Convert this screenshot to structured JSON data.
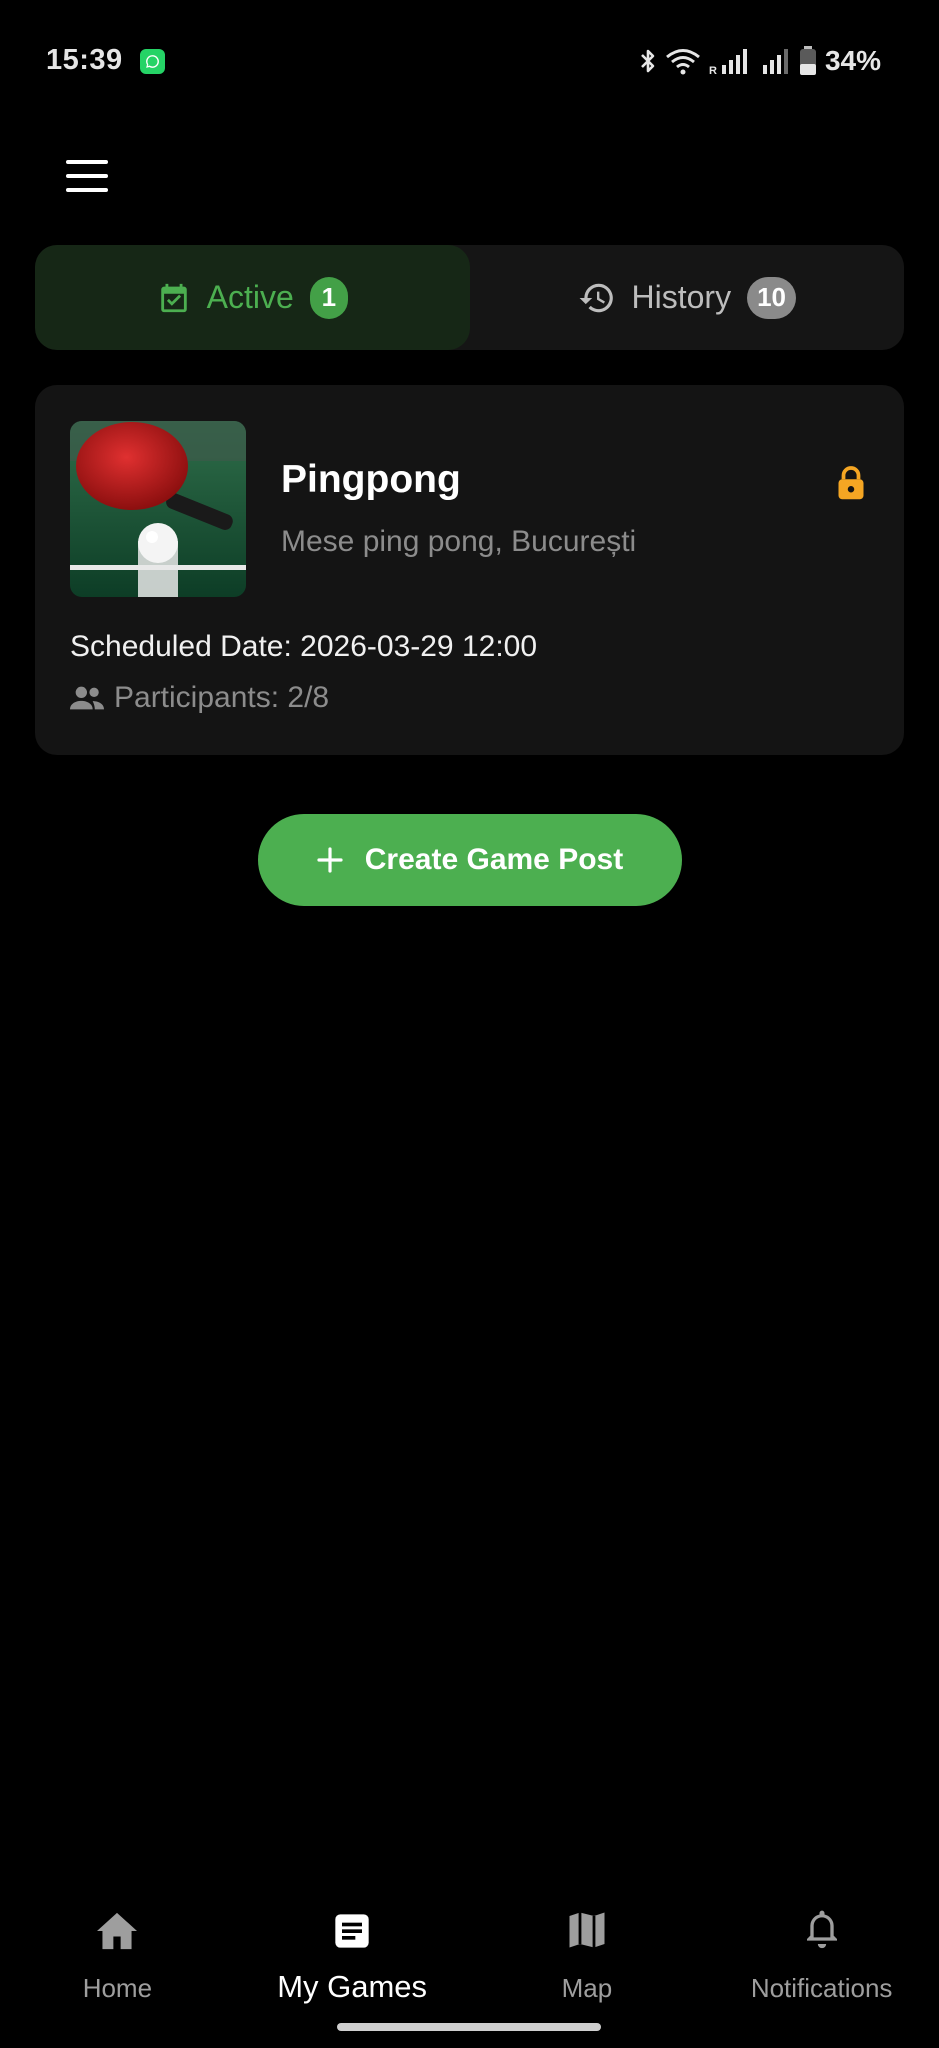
{
  "status_bar": {
    "time": "15:39",
    "battery": "34%",
    "icons": [
      "whatsapp-icon",
      "bluetooth-icon",
      "wifi-icon",
      "signal-icon",
      "battery-icon"
    ]
  },
  "header": {
    "menu_icon": "hamburger-menu-icon"
  },
  "tabs": [
    {
      "label": "Active",
      "badge": "1",
      "icon": "calendar-check-icon",
      "selected": true
    },
    {
      "label": "History",
      "badge": "10",
      "icon": "history-icon",
      "selected": false
    }
  ],
  "games": [
    {
      "title": "Pingpong",
      "location": "Mese ping pong, București",
      "scheduled": "Scheduled Date: 2026-03-29 12:00",
      "participants": "Participants: 2/8",
      "locked": true,
      "image": "ping-pong-paddle-and-ball"
    }
  ],
  "create_button": {
    "label": "Create Game Post"
  },
  "bottom_nav": [
    {
      "label": "Home",
      "icon": "home-icon",
      "active": false
    },
    {
      "label": "My Games",
      "icon": "article-icon",
      "active": true
    },
    {
      "label": "Map",
      "icon": "map-icon",
      "active": false
    },
    {
      "label": "Notifications",
      "icon": "bell-icon",
      "active": false
    }
  ],
  "colors": {
    "accent": "#4caf50",
    "background": "#000000",
    "card": "#141414",
    "lock": "#f5a623"
  }
}
